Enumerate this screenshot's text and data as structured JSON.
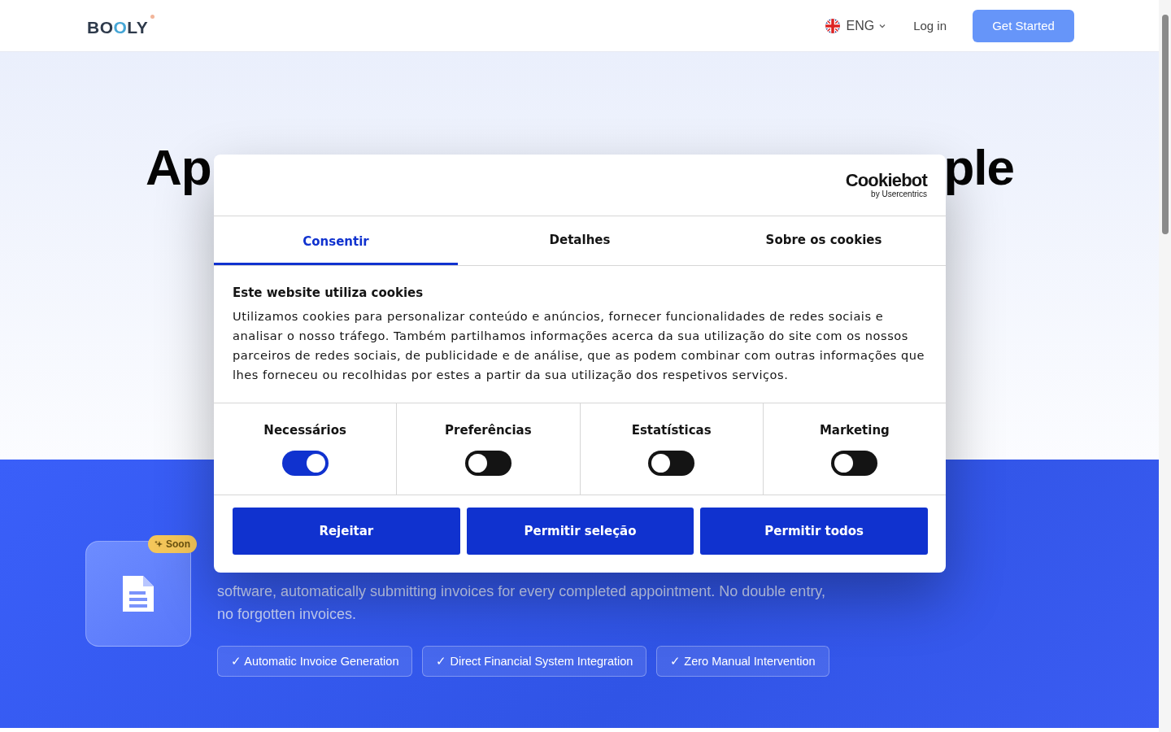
{
  "header": {
    "logo": "BOOLY",
    "language": "ENG",
    "login": "Log in",
    "cta": "Get Started"
  },
  "hero": {
    "title_left": "Ap",
    "title_right": "ple"
  },
  "feature": {
    "badge": "Soon",
    "description": "software, automatically submitting invoices for every completed appointment. No double entry, no forgotten invoices.",
    "chips": [
      "✓ Automatic Invoice Generation",
      "✓ Direct Financial System Integration",
      "✓ Zero Manual Intervention"
    ]
  },
  "cookie_dialog": {
    "brand": "Cookiebot",
    "brand_sub": "by Usercentrics",
    "tabs": [
      {
        "label": "Consentir",
        "selected": true
      },
      {
        "label": "Detalhes",
        "selected": false
      },
      {
        "label": "Sobre os cookies",
        "selected": false
      }
    ],
    "heading": "Este website utiliza cookies",
    "body": "Utilizamos cookies para personalizar conteúdo e anúncios, fornecer funcionalidades de redes sociais e analisar o nosso tráfego. Também partilhamos informações acerca da sua utilização do site com os nossos parceiros de redes sociais, de publicidade e de análise, que as podem combinar com outras informações que lhes forneceu ou recolhidas por estes a partir da sua utilização dos respetivos serviços.",
    "categories": [
      {
        "label": "Necessários",
        "on": true
      },
      {
        "label": "Preferências",
        "on": false
      },
      {
        "label": "Estatísticas",
        "on": false
      },
      {
        "label": "Marketing",
        "on": false
      }
    ],
    "buttons": [
      "Rejeitar",
      "Permitir seleção",
      "Permitir todos"
    ]
  }
}
